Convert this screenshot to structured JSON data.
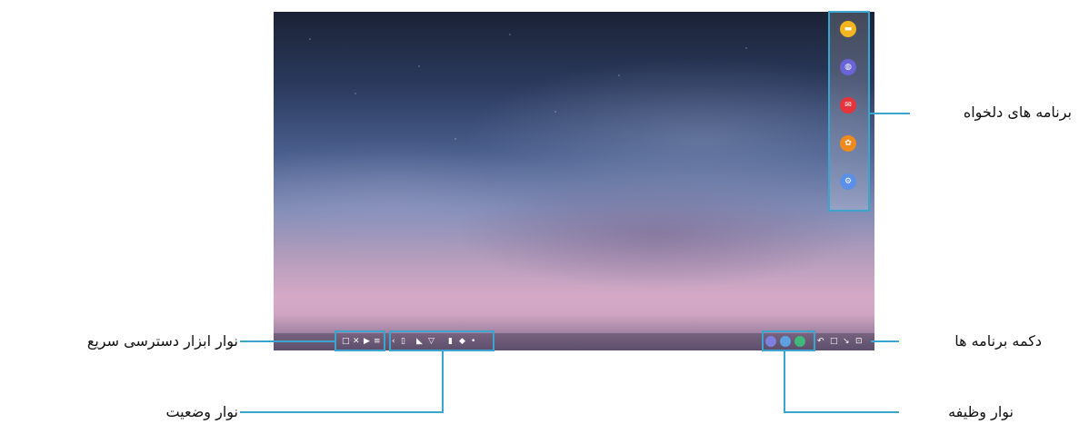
{
  "callouts": {
    "favorite_apps": "برنامه های دلخواه",
    "apps_button": "دکمه برنامه ها",
    "quick_access_toolbar": "نوار ابزار دسترسی سریع",
    "status_bar": "نوار وضعیت",
    "taskbar": "نوار وظیفه"
  },
  "favorite_apps": [
    {
      "icon": "folder-icon",
      "color": "#f2b51f"
    },
    {
      "icon": "internet-icon",
      "color": "#6a63d6"
    },
    {
      "icon": "email-icon",
      "color": "#e5343c"
    },
    {
      "icon": "gallery-icon",
      "color": "#ef8a1f"
    },
    {
      "icon": "settings-icon",
      "color": "#5b8fe8"
    }
  ],
  "quick_access_icons": [
    "square",
    "x",
    "play",
    "menu"
  ],
  "status_icons": [
    "chevron",
    "sim",
    "signal",
    "wifi",
    "battery",
    "sound",
    "dot"
  ],
  "taskbar_apps": [
    {
      "icon": "apps-button-icon",
      "color": "#7f7fe0"
    },
    {
      "icon": "app-icon-2",
      "color": "#5fa0e0"
    },
    {
      "icon": "app-icon-3",
      "color": "#3fb87a"
    }
  ],
  "taskbar_controls": [
    "back",
    "home",
    "recent",
    "screenshot"
  ],
  "colors": {
    "accent": "#3aa6cf"
  }
}
